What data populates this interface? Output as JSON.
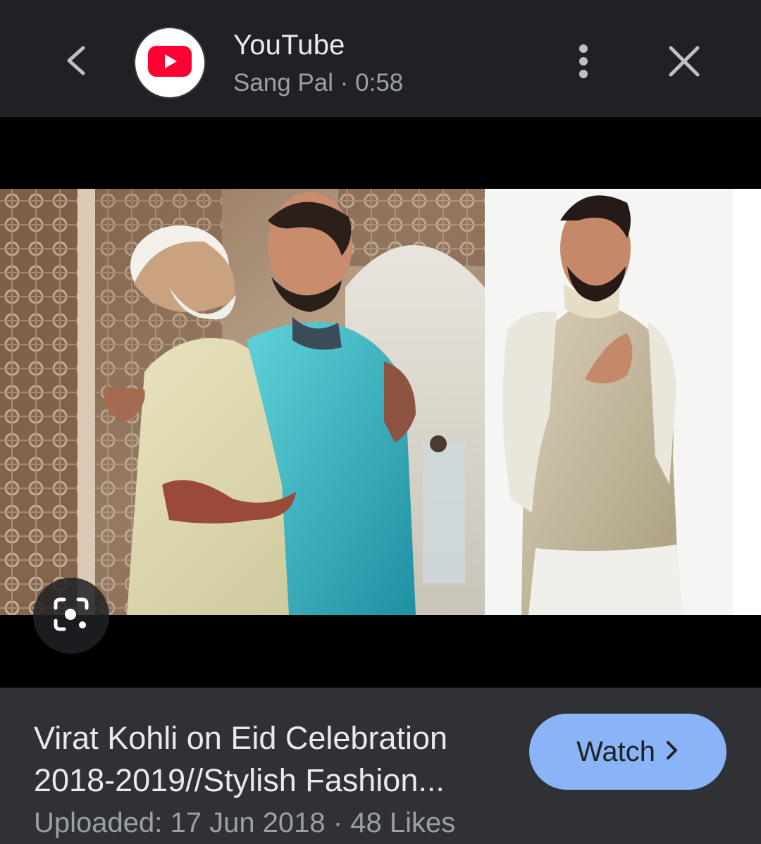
{
  "header": {
    "source_name": "YouTube",
    "source_meta": "Sang Pal · 0:58",
    "back_icon": "chevron-left-icon",
    "more_icon": "more-vert-icon",
    "close_icon": "close-icon",
    "logo_icon": "youtube-logo-icon"
  },
  "media": {
    "lens_icon": "google-lens-icon"
  },
  "video": {
    "title": "Virat Kohli on Eid Celebration 2018-2019//Stylish Fashion...",
    "meta": "Uploaded: 17 Jun 2018 · 48 Likes"
  },
  "actions": {
    "watch_label": "Watch",
    "watch_icon": "chevron-right-icon"
  },
  "colors": {
    "background": "#202124",
    "panel": "#303134",
    "accent": "#8ab4f8",
    "youtube_red": "#ff0033"
  }
}
